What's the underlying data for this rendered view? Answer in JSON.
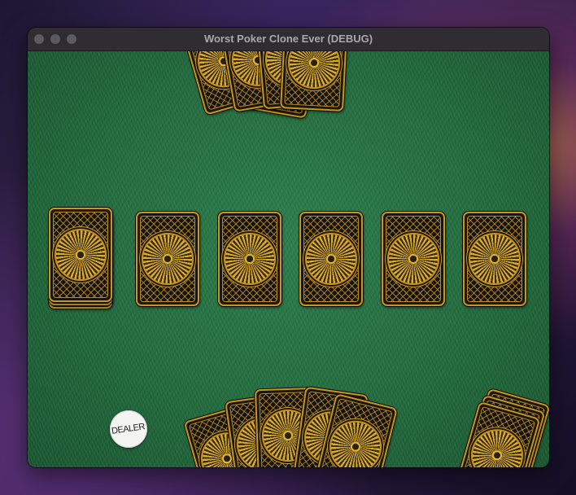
{
  "window": {
    "title": "Worst Poker Clone Ever (DEBUG)",
    "controls": [
      "close",
      "minimize",
      "zoom"
    ]
  },
  "table": {
    "felt_color": "#226a3d",
    "card_back": {
      "border_color": "#c9961c",
      "pattern": "gold lattice with sunburst medallion"
    },
    "opponent_hand": {
      "face_down_cards": 5
    },
    "deck": {
      "face_down_cards": 3
    },
    "community_cards": {
      "face_down_cards": 5
    },
    "player_hand": {
      "face_down_cards": 5
    },
    "discard_pile": {
      "face_down_cards": 3
    },
    "dealer_button": {
      "label": "DEALER"
    }
  }
}
